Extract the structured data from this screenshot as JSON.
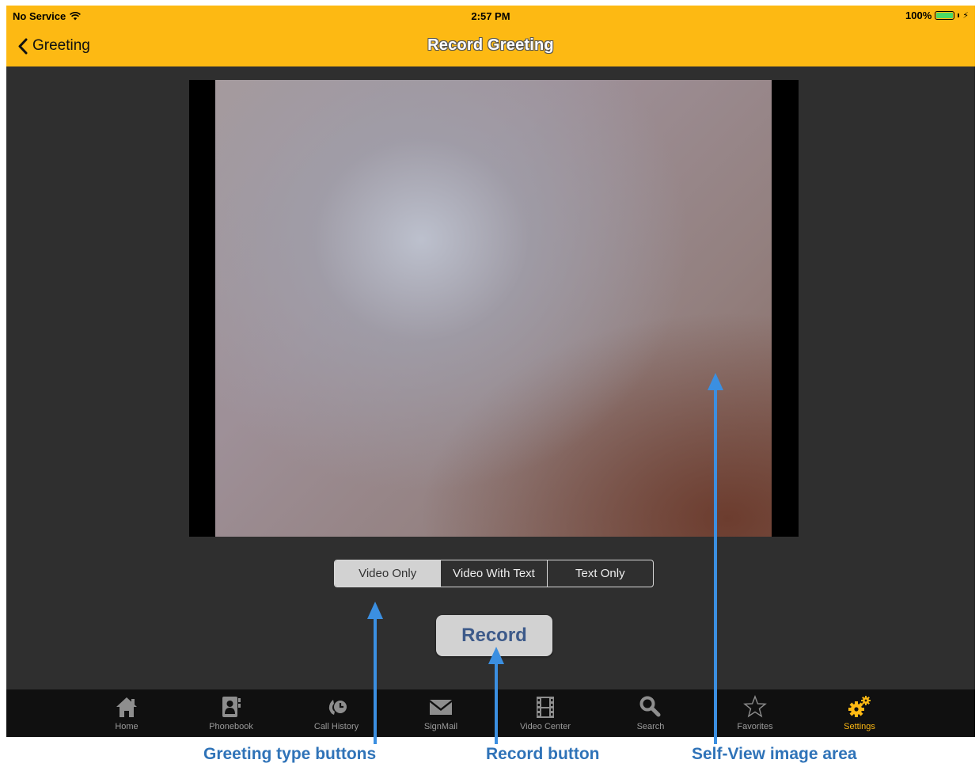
{
  "status_bar": {
    "carrier": "No Service",
    "time": "2:57 PM",
    "battery": "100%"
  },
  "nav": {
    "back_label": "Greeting",
    "title": "Record Greeting"
  },
  "greeting_types": {
    "options": [
      "Video Only",
      "Video With Text",
      "Text Only"
    ],
    "selected": "Video Only"
  },
  "record_label": "Record",
  "tabs": [
    {
      "label": "Home",
      "icon": "home-icon"
    },
    {
      "label": "Phonebook",
      "icon": "phonebook-icon"
    },
    {
      "label": "Call History",
      "icon": "call-history-icon"
    },
    {
      "label": "SignMail",
      "icon": "signmail-icon"
    },
    {
      "label": "Video Center",
      "icon": "film-icon"
    },
    {
      "label": "Search",
      "icon": "search-icon"
    },
    {
      "label": "Favorites",
      "icon": "star-icon"
    },
    {
      "label": "Settings",
      "icon": "gears-icon"
    }
  ],
  "active_tab": "Settings",
  "annotations": {
    "greeting_type_buttons": "Greeting type buttons",
    "record_button": "Record button",
    "self_view_area": "Self-View image area"
  },
  "colors": {
    "accent": "#fdb913",
    "background": "#2f2f2f",
    "tabbar": "#101010",
    "record_text": "#3d5a8a",
    "callout": "#2f73b8"
  }
}
